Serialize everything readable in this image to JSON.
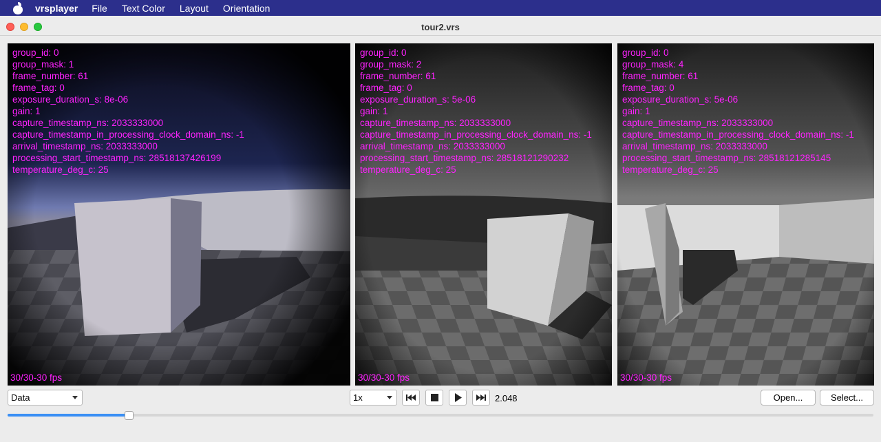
{
  "menubar": {
    "app_name": "vrsplayer",
    "items": [
      "File",
      "Text Color",
      "Layout",
      "Orientation"
    ]
  },
  "window": {
    "title": "tour2.vrs"
  },
  "panels": [
    {
      "lines": [
        "group_id: 0",
        "group_mask: 1",
        "frame_number: 61",
        "frame_tag: 0",
        "exposure_duration_s: 8e-06",
        "gain: 1",
        "capture_timestamp_ns: 2033333000",
        "capture_timestamp_in_processing_clock_domain_ns: -1",
        "arrival_timestamp_ns: 2033333000",
        "processing_start_timestamp_ns: 28518137426199",
        "temperature_deg_c: 25"
      ],
      "fps": "30/30-30 fps"
    },
    {
      "lines": [
        "group_id: 0",
        "group_mask: 2",
        "frame_number: 61",
        "frame_tag: 0",
        "exposure_duration_s: 5e-06",
        "gain: 1",
        "capture_timestamp_ns: 2033333000",
        "capture_timestamp_in_processing_clock_domain_ns: -1",
        "arrival_timestamp_ns: 2033333000",
        "processing_start_timestamp_ns: 28518121290232",
        "temperature_deg_c: 25"
      ],
      "fps": "30/30-30 fps"
    },
    {
      "lines": [
        "group_id: 0",
        "group_mask: 4",
        "frame_number: 61",
        "frame_tag: 0",
        "exposure_duration_s: 5e-06",
        "gain: 1",
        "capture_timestamp_ns: 2033333000",
        "capture_timestamp_in_processing_clock_domain_ns: -1",
        "arrival_timestamp_ns: 2033333000",
        "processing_start_timestamp_ns: 28518121285145",
        "temperature_deg_c: 25"
      ],
      "fps": "30/30-30 fps"
    }
  ],
  "controls": {
    "view_select": "Data",
    "speed_select": "1x",
    "time": "2.048",
    "open_label": "Open...",
    "select_label": "Select...",
    "icons": [
      "skip-back-icon",
      "stop-icon",
      "play-icon",
      "skip-forward-icon"
    ],
    "progress": 0.14
  },
  "colors": {
    "overlay_text": "#ff22ff",
    "menubar_bg": "#2c2f8c",
    "slider_fill": "#3a8ff5"
  }
}
